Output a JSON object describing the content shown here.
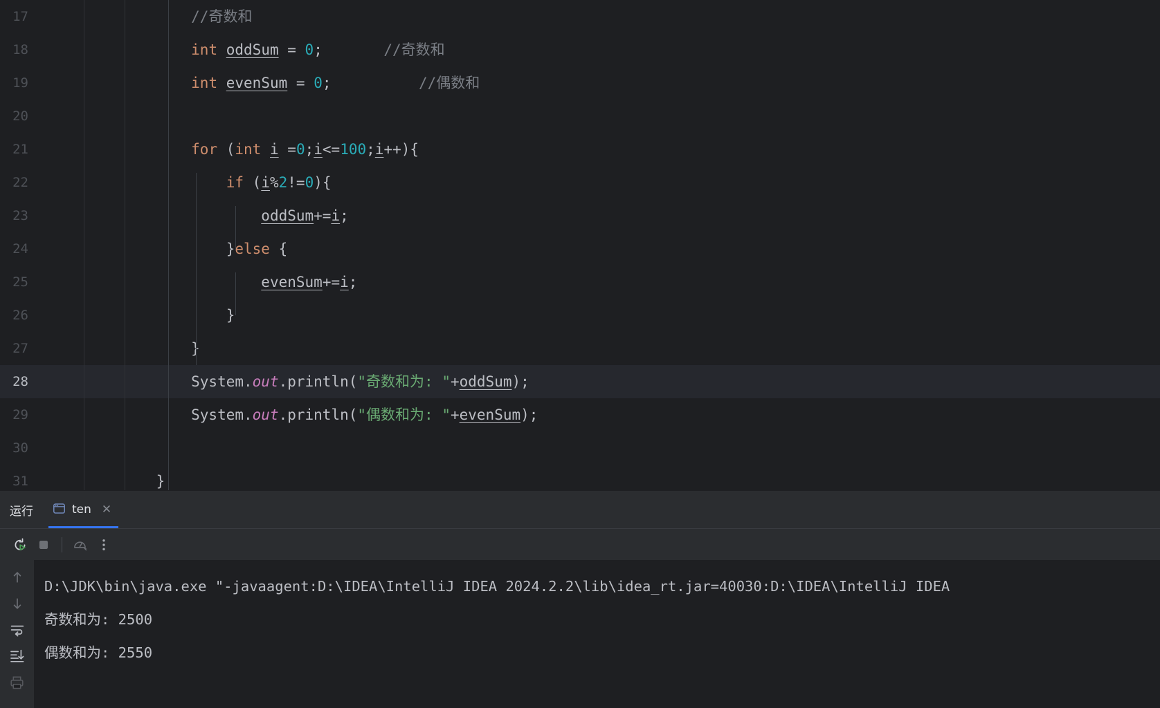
{
  "editor": {
    "lines": [
      {
        "number": "17",
        "current": false,
        "tokens": [
          {
            "text": "        ",
            "type": "plain"
          },
          {
            "text": "//奇数和",
            "type": "cmt"
          }
        ]
      },
      {
        "number": "18",
        "current": false,
        "tokens": [
          {
            "text": "        ",
            "type": "plain"
          },
          {
            "text": "int",
            "type": "kw"
          },
          {
            "text": " ",
            "type": "plain"
          },
          {
            "text": "oddSum",
            "type": "localvar"
          },
          {
            "text": " = ",
            "type": "plain"
          },
          {
            "text": "0",
            "type": "num"
          },
          {
            "text": ";",
            "type": "plain"
          },
          {
            "text": "       ",
            "type": "plain"
          },
          {
            "text": "//奇数和",
            "type": "cmt"
          }
        ]
      },
      {
        "number": "19",
        "current": false,
        "tokens": [
          {
            "text": "        ",
            "type": "plain"
          },
          {
            "text": "int",
            "type": "kw"
          },
          {
            "text": " ",
            "type": "plain"
          },
          {
            "text": "evenSum",
            "type": "localvar"
          },
          {
            "text": " = ",
            "type": "plain"
          },
          {
            "text": "0",
            "type": "num"
          },
          {
            "text": ";",
            "type": "plain"
          },
          {
            "text": "          ",
            "type": "plain"
          },
          {
            "text": "//偶数和",
            "type": "cmt"
          }
        ]
      },
      {
        "number": "20",
        "current": false,
        "tokens": []
      },
      {
        "number": "21",
        "current": false,
        "tokens": [
          {
            "text": "        ",
            "type": "plain"
          },
          {
            "text": "for",
            "type": "kw"
          },
          {
            "text": " (",
            "type": "plain"
          },
          {
            "text": "int",
            "type": "kw"
          },
          {
            "text": " ",
            "type": "plain"
          },
          {
            "text": "i",
            "type": "localvar"
          },
          {
            "text": " =",
            "type": "plain"
          },
          {
            "text": "0",
            "type": "num"
          },
          {
            "text": ";",
            "type": "plain"
          },
          {
            "text": "i",
            "type": "localvar"
          },
          {
            "text": "<=",
            "type": "plain"
          },
          {
            "text": "100",
            "type": "num"
          },
          {
            "text": ";",
            "type": "plain"
          },
          {
            "text": "i",
            "type": "localvar"
          },
          {
            "text": "++){",
            "type": "plain"
          }
        ]
      },
      {
        "number": "22",
        "current": false,
        "tokens": [
          {
            "text": "            ",
            "type": "plain"
          },
          {
            "text": "if",
            "type": "kw"
          },
          {
            "text": " (",
            "type": "plain"
          },
          {
            "text": "i",
            "type": "localvar"
          },
          {
            "text": "%",
            "type": "plain"
          },
          {
            "text": "2",
            "type": "num"
          },
          {
            "text": "!=",
            "type": "plain"
          },
          {
            "text": "0",
            "type": "num"
          },
          {
            "text": "){",
            "type": "plain"
          }
        ]
      },
      {
        "number": "23",
        "current": false,
        "tokens": [
          {
            "text": "                ",
            "type": "plain"
          },
          {
            "text": "oddSum",
            "type": "localvar"
          },
          {
            "text": "+=",
            "type": "plain"
          },
          {
            "text": "i",
            "type": "localvar"
          },
          {
            "text": ";",
            "type": "plain"
          }
        ]
      },
      {
        "number": "24",
        "current": false,
        "tokens": [
          {
            "text": "            ",
            "type": "plain"
          },
          {
            "text": "}",
            "type": "plain"
          },
          {
            "text": "else",
            "type": "kw"
          },
          {
            "text": " {",
            "type": "plain"
          }
        ]
      },
      {
        "number": "25",
        "current": false,
        "tokens": [
          {
            "text": "                ",
            "type": "plain"
          },
          {
            "text": "evenSum",
            "type": "localvar"
          },
          {
            "text": "+=",
            "type": "plain"
          },
          {
            "text": "i",
            "type": "localvar"
          },
          {
            "text": ";",
            "type": "plain"
          }
        ]
      },
      {
        "number": "26",
        "current": false,
        "tokens": [
          {
            "text": "            ",
            "type": "plain"
          },
          {
            "text": "}",
            "type": "plain"
          }
        ]
      },
      {
        "number": "27",
        "current": false,
        "tokens": [
          {
            "text": "        ",
            "type": "plain"
          },
          {
            "text": "}",
            "type": "plain"
          }
        ]
      },
      {
        "number": "28",
        "current": true,
        "tokens": [
          {
            "text": "        System.",
            "type": "plain"
          },
          {
            "text": "out",
            "type": "field"
          },
          {
            "text": ".println(",
            "type": "plain"
          },
          {
            "text": "\"奇数和为: \"",
            "type": "str"
          },
          {
            "text": "+",
            "type": "plain"
          },
          {
            "text": "oddSum",
            "type": "localvar"
          },
          {
            "text": ");",
            "type": "plain"
          }
        ]
      },
      {
        "number": "29",
        "current": false,
        "tokens": [
          {
            "text": "        System.",
            "type": "plain"
          },
          {
            "text": "out",
            "type": "field"
          },
          {
            "text": ".println(",
            "type": "plain"
          },
          {
            "text": "\"偶数和为: \"",
            "type": "str"
          },
          {
            "text": "+",
            "type": "plain"
          },
          {
            "text": "evenSum",
            "type": "localvar"
          },
          {
            "text": ");",
            "type": "plain"
          }
        ]
      },
      {
        "number": "30",
        "current": false,
        "tokens": []
      },
      {
        "number": "31",
        "current": false,
        "tokens": [
          {
            "text": "    ",
            "type": "plain"
          },
          {
            "text": "}",
            "type": "plain"
          }
        ]
      }
    ]
  },
  "run_panel": {
    "title": "运行",
    "tab": {
      "label": "ten",
      "icon": "console-icon",
      "close_label": "✕"
    },
    "toolbar": {
      "rerun_label": "Rerun",
      "stop_label": "Stop",
      "profiler_label": "Profiler",
      "more_label": "More options"
    },
    "console_gutter": {
      "up_label": "Previous occurrence",
      "down_label": "Next occurrence",
      "soft_wrap_label": "Soft-Wrap",
      "scroll_end_label": "Scroll to the end",
      "print_label": "Print"
    },
    "console_lines": [
      "D:\\JDK\\bin\\java.exe \"-javaagent:D:\\IDEA\\IntelliJ IDEA 2024.2.2\\lib\\idea_rt.jar=40030:D:\\IDEA\\IntelliJ IDEA",
      "奇数和为: 2500",
      "偶数和为: 2550"
    ]
  },
  "colors": {
    "editor_bg": "#1e1f22",
    "panel_bg": "#2b2d30",
    "current_line": "#26282e",
    "accent_blue": "#3574f0",
    "keyword": "#cf8e6d",
    "number": "#2aacb8",
    "string": "#6aab73",
    "comment": "#7a7e85",
    "field": "#c77dbb",
    "text": "#bcbec4"
  }
}
